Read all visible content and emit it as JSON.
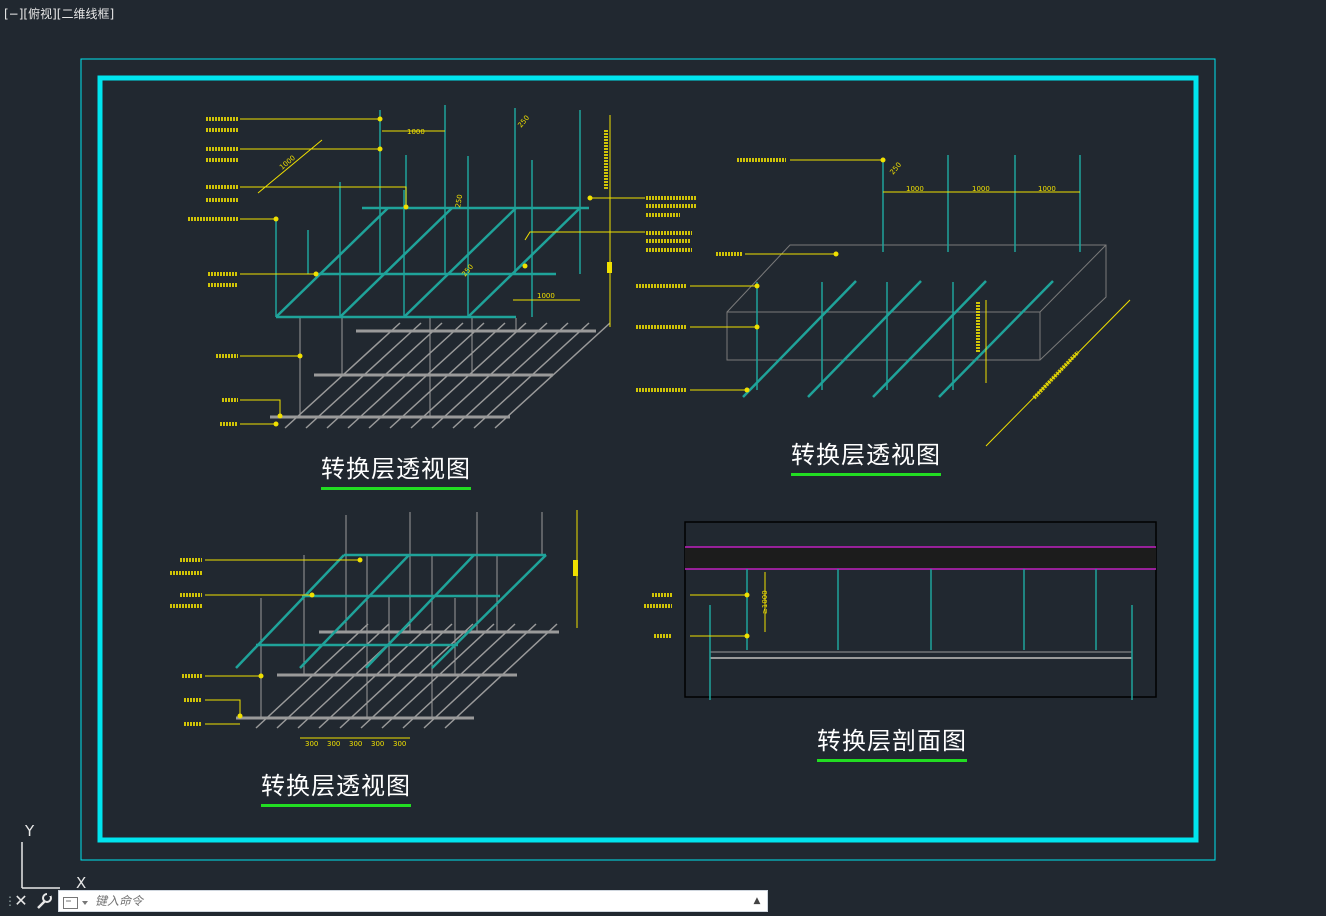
{
  "viewport": {
    "label": "[−][俯视][二维线框]"
  },
  "titles": {
    "top_left": "转换层透视图",
    "top_right": "转换层透视图",
    "bottom_left": "转换层透视图",
    "bottom_right": "转换层剖面图"
  },
  "dimensions": {
    "tl_1000_top": "1000",
    "tl_1000_diag": "1000",
    "tl_1000_bottom": "1000",
    "tl_250_a": "250",
    "tl_250_b": "250",
    "tl_250_c": "250",
    "tr_250": "250",
    "tr_1000_a": "1000",
    "tr_1000_b": "1000",
    "tr_1000_c": "1000",
    "bl_300": [
      "300",
      "300",
      "300",
      "300",
      "300"
    ],
    "br_ge1000": "≥1000"
  },
  "ucs": {
    "y_label": "Y",
    "x_label": "X"
  },
  "command_line": {
    "close_glyph": "✕",
    "placeholder": "键入命令",
    "up_glyph": "▲"
  },
  "colors": {
    "background": "#212830",
    "frame": "#00e5ee",
    "annotation": "#f0e000",
    "member": "#1fa39a",
    "steel": "#9a9a9a",
    "section_band": "#c020c0",
    "title_underline": "#22dd22"
  }
}
